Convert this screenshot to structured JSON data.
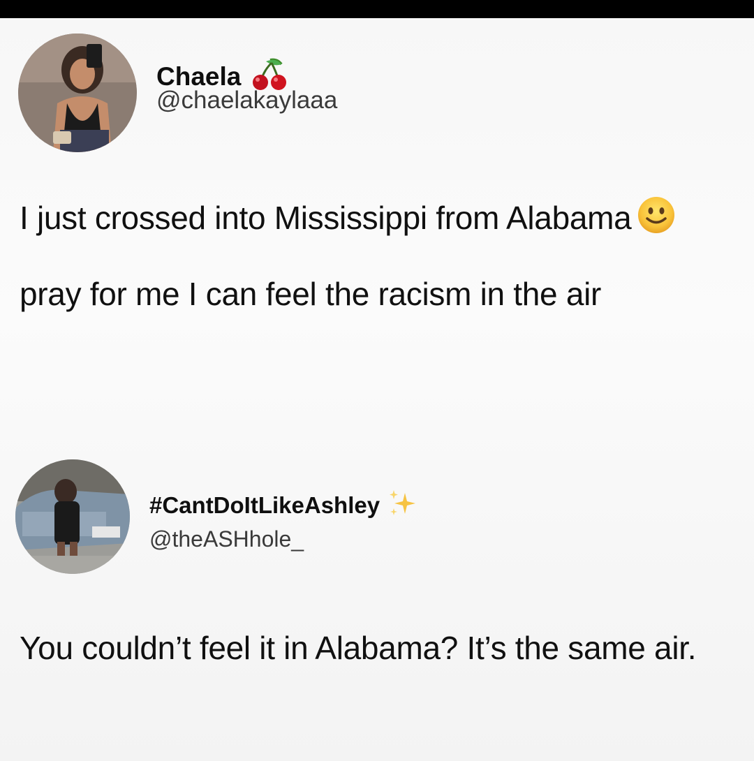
{
  "tweets": [
    {
      "display_name": "Chaela",
      "name_emoji": "cherries-icon",
      "handle": "@chaelakaylaaa",
      "text_before_emoji": "I just crossed into Mississippi from Alabama",
      "text_emoji": "slightly-smiling-face-icon",
      "text_after_emoji": "pray for me I can feel the racism in the air"
    },
    {
      "display_name": "#CantDoItLikeAshley",
      "name_emoji": "sparkles-icon",
      "handle": "@theASHhole_",
      "text": "You couldn’t feel it in Alabama? It’s the same air."
    }
  ]
}
